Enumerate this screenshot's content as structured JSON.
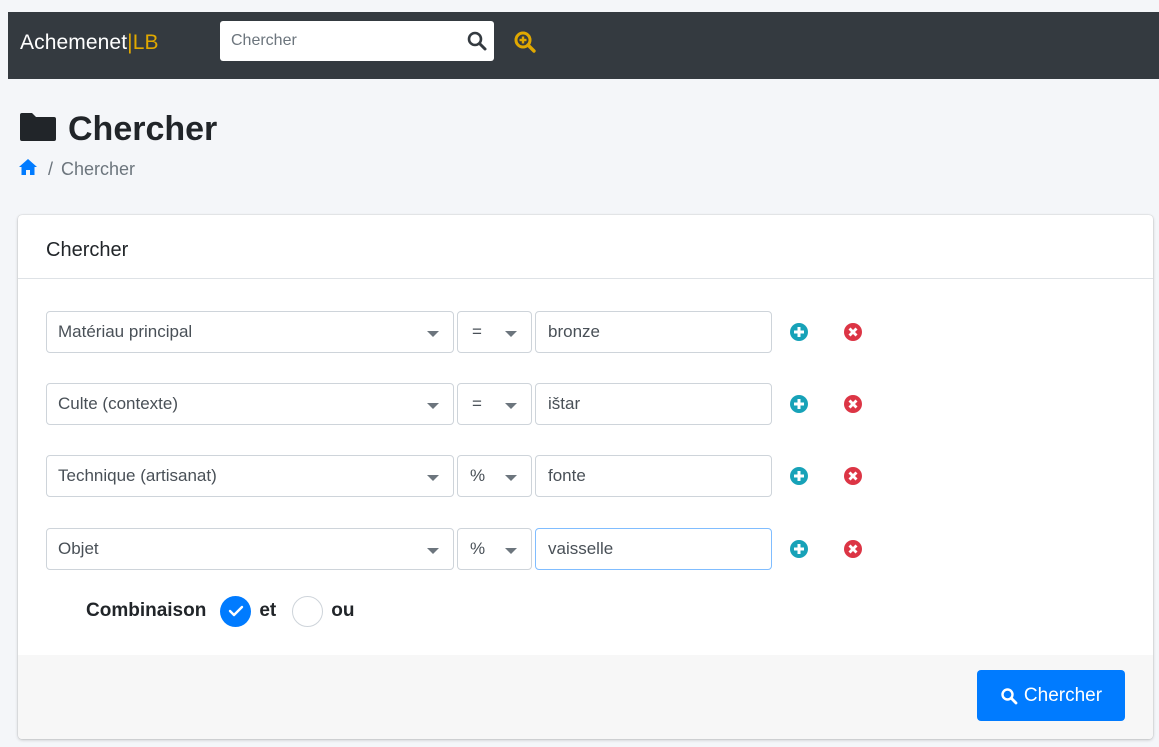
{
  "navbar": {
    "brand_main": "Achemenet",
    "brand_sep": "|",
    "brand_suffix": "LB",
    "search_placeholder": "Chercher",
    "search_icon": "search-icon",
    "advanced_search_icon": "search-plus-icon"
  },
  "page": {
    "title": "Chercher",
    "title_icon": "folder-icon",
    "breadcrumb": {
      "home_icon": "home-icon",
      "separator": "/",
      "current": "Chercher"
    }
  },
  "card": {
    "title": "Chercher",
    "rows": [
      {
        "field": "Matériau principal",
        "operator": "=",
        "value": "bronze"
      },
      {
        "field": "Culte (contexte)",
        "operator": "=",
        "value": "ištar"
      },
      {
        "field": "Technique (artisanat)",
        "operator": "%",
        "value": "fonte"
      },
      {
        "field": "Objet",
        "operator": "%",
        "value": "vaisselle"
      }
    ],
    "combination": {
      "label": "Combinaison",
      "options": [
        {
          "label": "et",
          "selected": true
        },
        {
          "label": "ou",
          "selected": false
        }
      ]
    },
    "submit_label": "Chercher"
  },
  "colors": {
    "navbar": "#343a40",
    "brand_accent": "#e0a800",
    "primary": "#007bff",
    "add": "#17a2b8",
    "remove": "#dc3545"
  }
}
